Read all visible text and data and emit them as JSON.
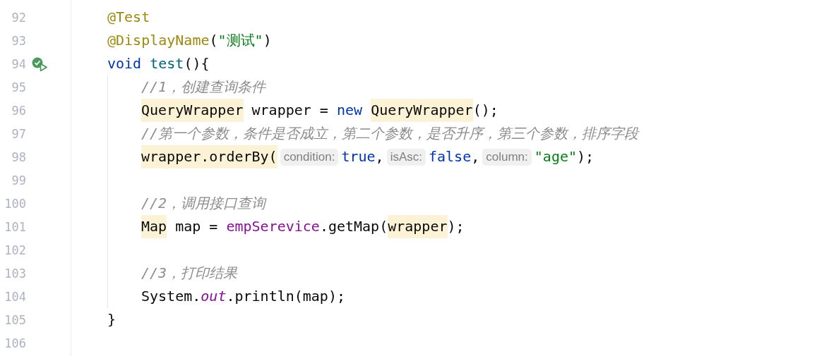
{
  "editor": {
    "lines": [
      {
        "number": "92",
        "tokens": [
          {
            "text": "@Test",
            "kind": "annotation"
          }
        ]
      },
      {
        "number": "93",
        "tokens": [
          {
            "text": "@DisplayName",
            "kind": "annotation"
          },
          {
            "text": "(",
            "kind": "plain"
          },
          {
            "text": "\"测试\"",
            "kind": "string"
          },
          {
            "text": ")",
            "kind": "plain"
          }
        ]
      },
      {
        "number": "94",
        "run_marker": true,
        "tokens": [
          {
            "text": "void ",
            "kind": "keyword"
          },
          {
            "text": "test",
            "kind": "method"
          },
          {
            "text": "(){",
            "kind": "plain"
          }
        ],
        "children": [
          {
            "number": "95",
            "tokens": [
              {
                "text": "//1，创建查询条件",
                "kind": "comment"
              }
            ]
          },
          {
            "number": "96",
            "tokens": [
              {
                "text": "QueryWrapper",
                "kind": "plain",
                "highlighted": true
              },
              {
                "text": " wrapper = ",
                "kind": "plain"
              },
              {
                "text": "new ",
                "kind": "keyword"
              },
              {
                "text": "QueryWrapper",
                "kind": "plain",
                "highlighted": true
              },
              {
                "text": "();",
                "kind": "plain"
              }
            ]
          },
          {
            "number": "97",
            "tokens": [
              {
                "text": "//第一个参数，条件是否成立，第二个参数，是否升序，第三个参数，排序字段",
                "kind": "comment"
              }
            ]
          },
          {
            "number": "98",
            "tokens": [
              {
                "text": "wrapper.orderBy(",
                "kind": "plain",
                "highlighted": true
              },
              {
                "text": "condition:",
                "kind": "hint"
              },
              {
                "text": "true",
                "kind": "keyword"
              },
              {
                "text": ",",
                "kind": "plain"
              },
              {
                "text": "isAsc:",
                "kind": "hint"
              },
              {
                "text": "false",
                "kind": "keyword"
              },
              {
                "text": ",",
                "kind": "plain"
              },
              {
                "text": "column:",
                "kind": "hint"
              },
              {
                "text": "\"age\"",
                "kind": "string"
              },
              {
                "text": ");",
                "kind": "plain"
              }
            ]
          },
          {
            "number": "99"
          },
          {
            "number": "100",
            "tokens": [
              {
                "text": "//2，调用接口查询",
                "kind": "comment"
              }
            ]
          },
          {
            "number": "101",
            "tokens": [
              {
                "text": "Map",
                "kind": "plain",
                "highlighted": true
              },
              {
                "text": " map = ",
                "kind": "plain"
              },
              {
                "text": "empSerevice",
                "kind": "field"
              },
              {
                "text": ".getMap(",
                "kind": "plain"
              },
              {
                "text": "wrapper",
                "kind": "plain",
                "highlighted": true
              },
              {
                "text": ");",
                "kind": "plain"
              }
            ]
          },
          {
            "number": "102"
          },
          {
            "number": "103",
            "tokens": [
              {
                "text": "//3，打印结果",
                "kind": "comment"
              }
            ]
          },
          {
            "number": "104",
            "tokens": [
              {
                "text": "System.",
                "kind": "plain"
              },
              {
                "text": "out",
                "kind": "static-field"
              },
              {
                "text": ".println(map);",
                "kind": "plain"
              }
            ]
          }
        ]
      },
      {
        "number": "105",
        "tokens": [
          {
            "text": "}",
            "kind": "plain"
          }
        ]
      },
      {
        "number": "106"
      }
    ]
  }
}
